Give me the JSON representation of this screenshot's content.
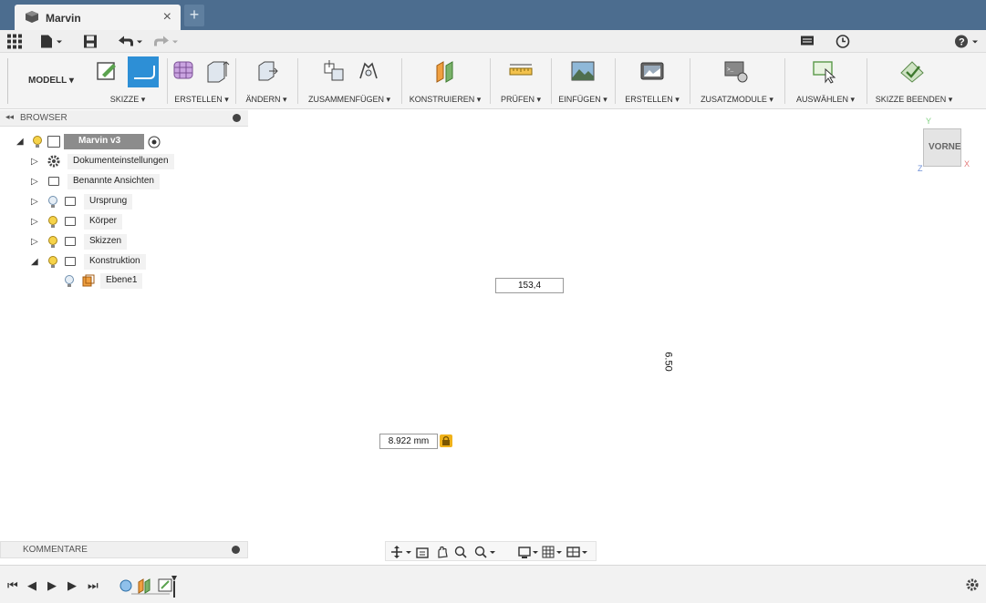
{
  "window": {
    "tab_title": "Marvin",
    "close_glyph": "×",
    "add_tab_glyph": "+"
  },
  "ribbon": {
    "mode_label": "MODELL ▾",
    "groups": [
      {
        "label": "SKIZZE ▾"
      },
      {
        "label": "ERSTELLEN ▾"
      },
      {
        "label": "ÄNDERN ▾"
      },
      {
        "label": "ZUSAMMENFÜGEN ▾"
      },
      {
        "label": "KONSTRUIEREN ▾"
      },
      {
        "label": "PRÜFEN ▾"
      },
      {
        "label": "EINFÜGEN ▾"
      },
      {
        "label": "ERSTELLEN ▾"
      },
      {
        "label": "ZUSATZMODULE ▾"
      },
      {
        "label": "AUSWÄHLEN ▾"
      },
      {
        "label": "SKIZZE BEENDEN ▾"
      }
    ]
  },
  "browser": {
    "title": "BROWSER",
    "collapse_glyph": "◂◂",
    "root": {
      "label": "Marvin v3"
    },
    "items": [
      {
        "label": "Dokumenteinstellungen"
      },
      {
        "label": "Benannte Ansichten"
      },
      {
        "label": "Ursprung"
      },
      {
        "label": "Körper"
      },
      {
        "label": "Skizzen"
      },
      {
        "label": "Konstruktion"
      },
      {
        "label": "Ebene1"
      }
    ]
  },
  "viewcube": {
    "face_label": "VORNE",
    "axis_y": "Y",
    "axis_x": "X",
    "axis_z": "Z"
  },
  "sketch": {
    "angle_input_value": "153,4",
    "length_input_value": "8.922 mm",
    "vertical_dimension": "6.50"
  },
  "comments": {
    "title": "KOMMENTARE"
  },
  "colors": {
    "titlebar": "#4c6d8f",
    "accent": "#2d8fd6",
    "axis_red": "#e06060",
    "axis_green": "#60c060",
    "lock": "#f0b21a"
  },
  "icons": {
    "app_menu": "grid-icon",
    "file": "file-icon",
    "save": "save-icon",
    "undo": "undo-icon",
    "redo": "redo-icon",
    "comments": "comment-icon",
    "history": "clock-icon",
    "help": "help-icon",
    "settings": "gear-icon"
  }
}
